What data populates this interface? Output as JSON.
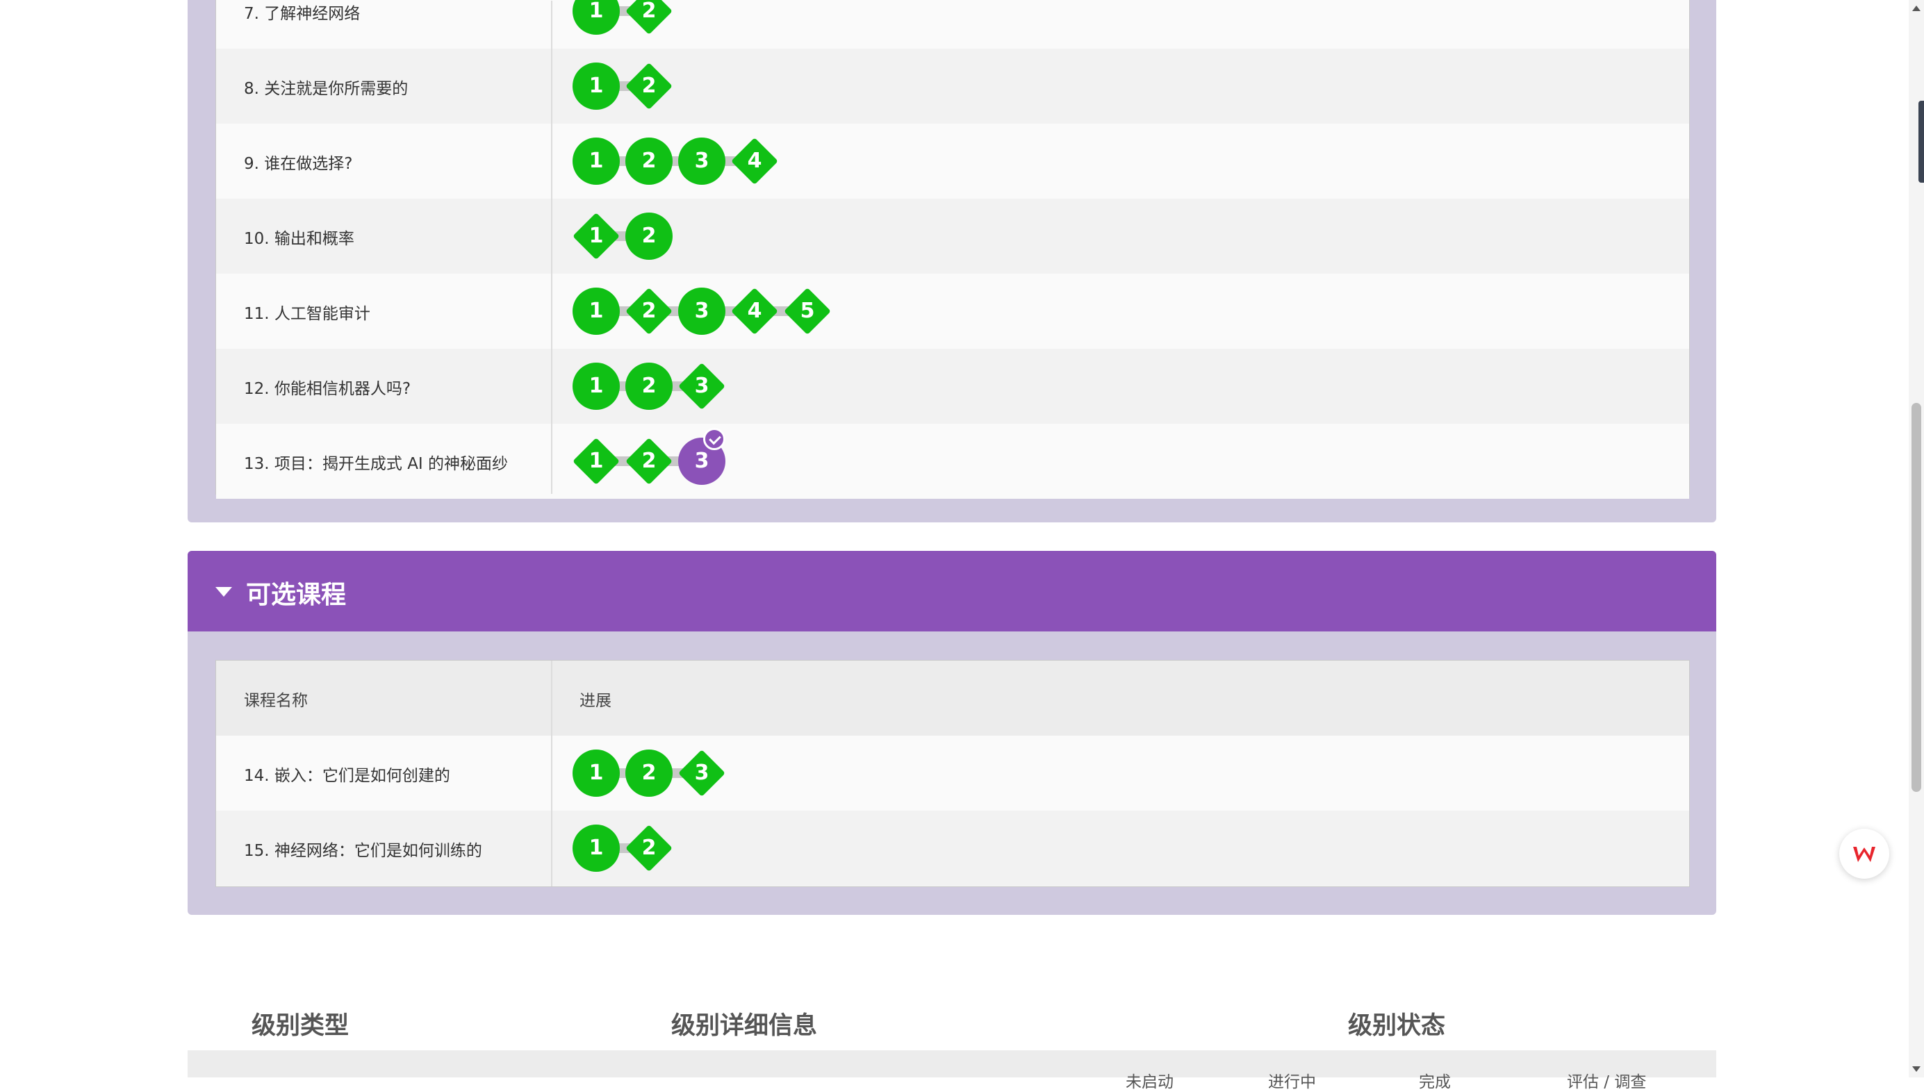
{
  "required_section": {
    "rows": [
      {
        "name": "7. 了解神经网络",
        "nodes": [
          {
            "n": "1",
            "shape": "circle"
          },
          {
            "n": "2",
            "shape": "diamond"
          }
        ]
      },
      {
        "name": "8. 关注就是你所需要的",
        "nodes": [
          {
            "n": "1",
            "shape": "circle"
          },
          {
            "n": "2",
            "shape": "diamond"
          }
        ]
      },
      {
        "name": "9. 谁在做选择?",
        "nodes": [
          {
            "n": "1",
            "shape": "circle"
          },
          {
            "n": "2",
            "shape": "circle"
          },
          {
            "n": "3",
            "shape": "circle"
          },
          {
            "n": "4",
            "shape": "diamond"
          }
        ]
      },
      {
        "name": "10. 输出和概率",
        "nodes": [
          {
            "n": "1",
            "shape": "diamond"
          },
          {
            "n": "2",
            "shape": "circle"
          }
        ]
      },
      {
        "name": "11. 人工智能审计",
        "nodes": [
          {
            "n": "1",
            "shape": "circle"
          },
          {
            "n": "2",
            "shape": "diamond"
          },
          {
            "n": "3",
            "shape": "circle"
          },
          {
            "n": "4",
            "shape": "diamond"
          },
          {
            "n": "5",
            "shape": "diamond"
          }
        ]
      },
      {
        "name": "12. 你能相信机器人吗?",
        "nodes": [
          {
            "n": "1",
            "shape": "circle"
          },
          {
            "n": "2",
            "shape": "circle"
          },
          {
            "n": "3",
            "shape": "diamond"
          }
        ]
      },
      {
        "name": "13. 项目：揭开生成式 AI 的神秘面纱",
        "nodes": [
          {
            "n": "1",
            "shape": "diamond"
          },
          {
            "n": "2",
            "shape": "diamond"
          },
          {
            "n": "3",
            "shape": "circle",
            "current": true
          }
        ]
      }
    ]
  },
  "optional_section": {
    "title": "可选课程",
    "header": {
      "name": "课程名称",
      "progress": "进展"
    },
    "rows": [
      {
        "name": "14. 嵌入：它们是如何创建的",
        "nodes": [
          {
            "n": "1",
            "shape": "circle"
          },
          {
            "n": "2",
            "shape": "circle"
          },
          {
            "n": "3",
            "shape": "diamond"
          }
        ]
      },
      {
        "name": "15. 神经网络：它们是如何训练的",
        "nodes": [
          {
            "n": "1",
            "shape": "circle"
          },
          {
            "n": "2",
            "shape": "diamond"
          }
        ]
      }
    ]
  },
  "level_section": {
    "type_heading": "级别类型",
    "details_heading": "级别详细信息",
    "status_heading": "级别状态",
    "status_columns": [
      "未启动",
      "进行中",
      "完成",
      "评估 / 调查"
    ]
  },
  "colors": {
    "complete": "#10c015",
    "current": "#8b52b8",
    "section_header": "#8b52b8",
    "panel_bg": "#cfc9df"
  },
  "icons": {
    "caret": "caret-down-icon",
    "check": "check-badge-icon",
    "wps": "wps-logo-icon"
  }
}
